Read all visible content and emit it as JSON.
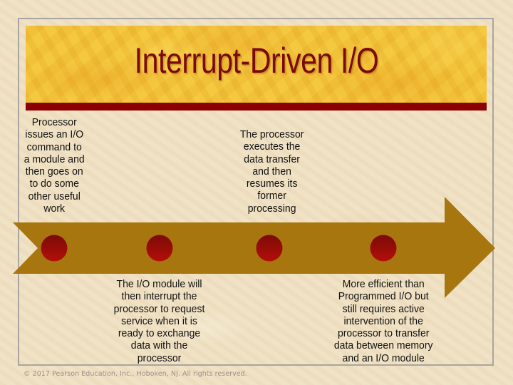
{
  "slide": {
    "title": "Interrupt-Driven I/O",
    "footer": "© 2017 Pearson Education, Inc., Hoboken, NJ. All rights reserved."
  },
  "colors": {
    "background": "#efe0c2",
    "header_band": "#f2c437",
    "header_rule": "#8b0000",
    "title_text": "#7a0a0a",
    "arrow": "#a8760e",
    "step_marker": "#a30d0d",
    "frame": "#aaa5a0"
  },
  "timeline": {
    "shape": "right-pointing chevron arrow",
    "steps": [
      {
        "position": "above",
        "text": "Processor\nissues an I/O\ncommand to\na module and\nthen goes on\nto do some\nother useful\nwork"
      },
      {
        "position": "below",
        "text": "The I/O module will\nthen interrupt the\nprocessor to request\nservice when it is\nready to exchange\ndata with the\nprocessor"
      },
      {
        "position": "above",
        "text": "The processor\nexecutes the\ndata transfer\nand then\nresumes its\nformer\nprocessing"
      },
      {
        "position": "below",
        "text": "More efficient than\nProgrammed I/O but\nstill requires active\nintervention of the\nprocessor to transfer\ndata between memory\nand an I/O module"
      }
    ]
  }
}
